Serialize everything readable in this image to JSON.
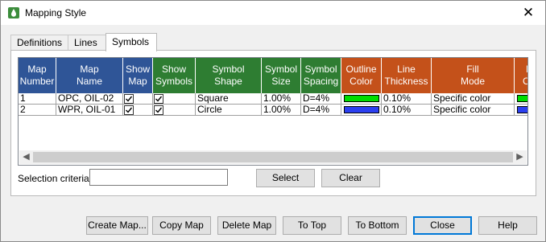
{
  "window": {
    "title": "Mapping Style",
    "close_glyph": "✕"
  },
  "tabs": [
    {
      "label": "Definitions"
    },
    {
      "label": "Lines"
    },
    {
      "label": "Symbols"
    }
  ],
  "table": {
    "headers": [
      {
        "lines": [
          "Map",
          "Number"
        ],
        "color": "#2f5597"
      },
      {
        "lines": [
          "Map",
          "Name"
        ],
        "color": "#2f5597"
      },
      {
        "lines": [
          "Show",
          "Map"
        ],
        "color": "#2f5597"
      },
      {
        "lines": [
          "Show",
          "Symbols"
        ],
        "color": "#2e7d32"
      },
      {
        "lines": [
          "Symbol",
          "Shape"
        ],
        "color": "#2e7d32"
      },
      {
        "lines": [
          "Symbol",
          "Size"
        ],
        "color": "#2e7d32"
      },
      {
        "lines": [
          "Symbol",
          "Spacing"
        ],
        "color": "#2e7d32"
      },
      {
        "lines": [
          "Outline",
          "Color"
        ],
        "color": "#c4511a"
      },
      {
        "lines": [
          "Line",
          "Thickness"
        ],
        "color": "#c4511a"
      },
      {
        "lines": [
          "Fill",
          "Mode"
        ],
        "color": "#c4511a"
      },
      {
        "lines": [
          "F",
          "Co"
        ],
        "color": "#c4511a"
      }
    ],
    "rows": [
      {
        "number": "1",
        "name": "OPC, OIL-02",
        "show_map": true,
        "show_symbols": true,
        "shape": "Square",
        "size": "1.00%",
        "spacing": "D=4%",
        "outline_color": "#00dd00",
        "thickness": "0.10%",
        "fill_mode": "Specific color",
        "fill_color": "#00dd00"
      },
      {
        "number": "2",
        "name": "WPR, OIL-01",
        "show_map": true,
        "show_symbols": true,
        "shape": "Circle",
        "size": "1.00%",
        "spacing": "D=4%",
        "outline_color": "#2b3ff0",
        "thickness": "0.10%",
        "fill_mode": "Specific color",
        "fill_color": "#2b3ff0"
      }
    ]
  },
  "selection": {
    "label": "Selection criteria:",
    "value": "",
    "select_label": "Select",
    "clear_label": "Clear"
  },
  "buttons": {
    "create_map": "Create Map...",
    "copy_map": "Copy Map",
    "delete_map": "Delete Map",
    "to_top": "To Top",
    "to_bottom": "To Bottom",
    "close": "Close",
    "help": "Help"
  },
  "icons": {
    "app": "drop-icon",
    "scroll_left": "◀",
    "scroll_right": "▶"
  }
}
